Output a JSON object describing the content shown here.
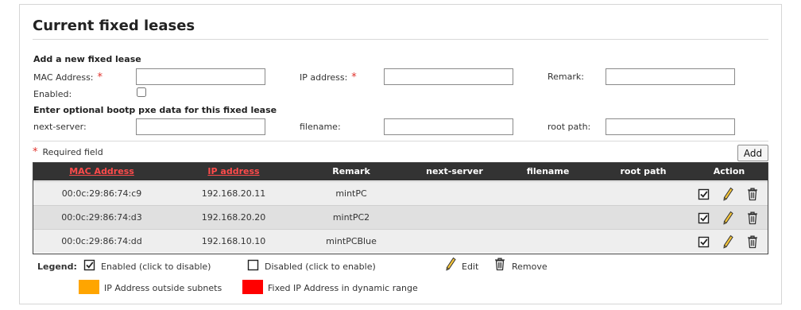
{
  "page": {
    "title": "Current fixed leases"
  },
  "add_form": {
    "heading": "Add a new fixed lease",
    "mac_label": "MAC Address:",
    "ip_label": "IP address:",
    "remark_label": "Remark:",
    "enabled_label": "Enabled:",
    "required_mark": "*",
    "mac_value": "",
    "ip_value": "",
    "remark_value": "",
    "enabled_checked": false,
    "bootp_heading": "Enter optional bootp pxe data for this fixed lease",
    "next_server_label": "next-server:",
    "filename_label": "filename:",
    "root_path_label": "root path:",
    "next_server_value": "",
    "filename_value": "",
    "root_path_value": "",
    "required_note": "Required field",
    "add_button": "Add"
  },
  "table": {
    "columns": [
      "MAC Address",
      "IP address",
      "Remark",
      "next-server",
      "filename",
      "root path",
      "Action"
    ],
    "sortable_columns": [
      "MAC Address",
      "IP address"
    ],
    "rows": [
      {
        "mac": "00:0c:29:86:74:c9",
        "ip": "192.168.20.11",
        "remark": "mintPC",
        "next_server": "",
        "filename": "",
        "root_path": "",
        "enabled": true
      },
      {
        "mac": "00:0c:29:86:74:d3",
        "ip": "192.168.20.20",
        "remark": "mintPC2",
        "next_server": "",
        "filename": "",
        "root_path": "",
        "enabled": true
      },
      {
        "mac": "00:0c:29:86:74:dd",
        "ip": "192.168.10.10",
        "remark": "mintPCBlue",
        "next_server": "",
        "filename": "",
        "root_path": "",
        "enabled": true
      }
    ],
    "header_bg": "#333333",
    "sort_link_color": "#ff4b4b"
  },
  "legend": {
    "label": "Legend:",
    "enabled": "Enabled (click to disable)",
    "disabled": "Disabled (click to enable)",
    "edit": "Edit",
    "remove": "Remove",
    "outside_subnets": "IP Address outside subnets",
    "dynamic_range": "Fixed IP Address in dynamic range",
    "outside_subnets_color": "#ffa500",
    "dynamic_range_color": "#ff0000"
  },
  "icons": {
    "checked_box": "checked-box-icon",
    "edit": "pencil-icon",
    "remove": "trash-icon"
  }
}
